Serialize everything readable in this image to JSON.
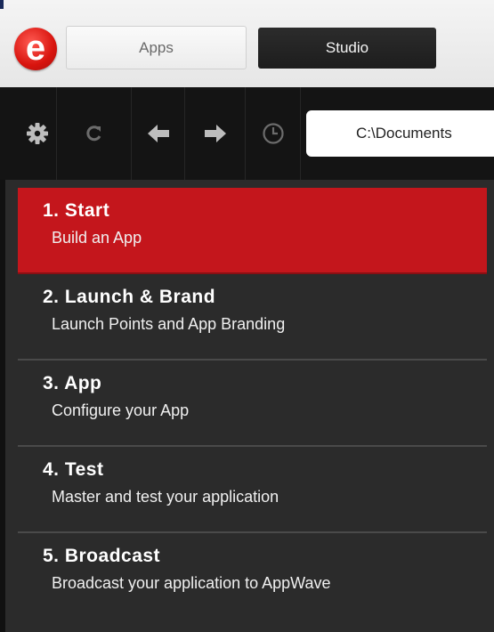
{
  "header": {
    "logo_letter": "e",
    "tabs": [
      {
        "label": "Apps"
      },
      {
        "label": "Studio"
      }
    ]
  },
  "toolbar": {
    "icons": [
      "gear-icon",
      "refresh-icon",
      "back-arrow-icon",
      "forward-arrow-icon",
      "history-clock-icon"
    ],
    "path": "C:\\Documents"
  },
  "steps": [
    {
      "title": "1. Start",
      "subtitle": "Build an App",
      "active": true
    },
    {
      "title": "2. Launch  & Brand",
      "subtitle": "Launch Points and App Branding",
      "active": false
    },
    {
      "title": "3. App",
      "subtitle": "Configure your App",
      "active": false
    },
    {
      "title": "4. Test",
      "subtitle": "Master and test your application",
      "active": false
    },
    {
      "title": "5. Broadcast",
      "subtitle": "Broadcast your application to AppWave",
      "active": false
    }
  ],
  "colors": {
    "accent": "#c4161c",
    "panel": "#2b2b2b",
    "toolbar": "#141414"
  }
}
